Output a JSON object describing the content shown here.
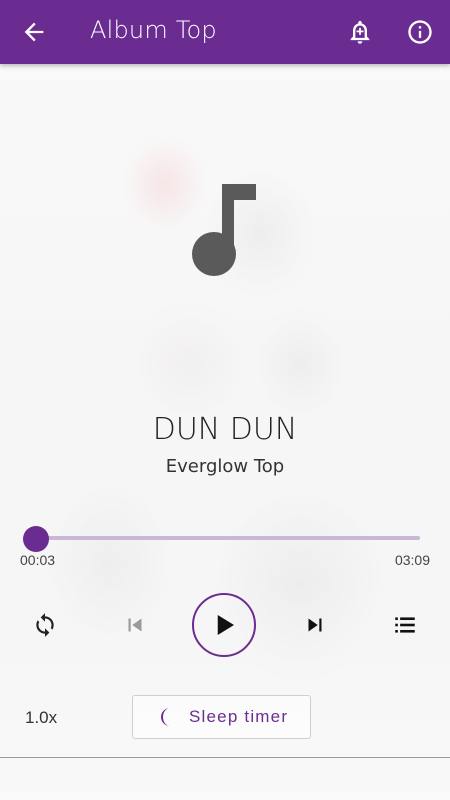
{
  "app_bar": {
    "title": "Album Top",
    "back_icon": "arrow-back-icon",
    "alarm_icon": "alarm-add-icon",
    "info_icon": "info-icon",
    "color": "#6a2c91"
  },
  "now_playing": {
    "title": "DUN DUN",
    "artist": "Everglow Top",
    "art_icon": "music-note-icon"
  },
  "progress": {
    "current": "00:03",
    "total": "03:09",
    "fraction": 0.016
  },
  "controls": {
    "repeat_icon": "repeat-icon",
    "previous_icon": "skip-previous-icon",
    "play_icon": "play-icon",
    "next_icon": "skip-next-icon",
    "queue_icon": "queue-list-icon"
  },
  "footer": {
    "speed": "1.0x",
    "sleep_timer_label": "Sleep timer",
    "sleep_icon": "moon-icon"
  },
  "colors": {
    "accent": "#6a2c91",
    "track": "#c9b7d6"
  }
}
